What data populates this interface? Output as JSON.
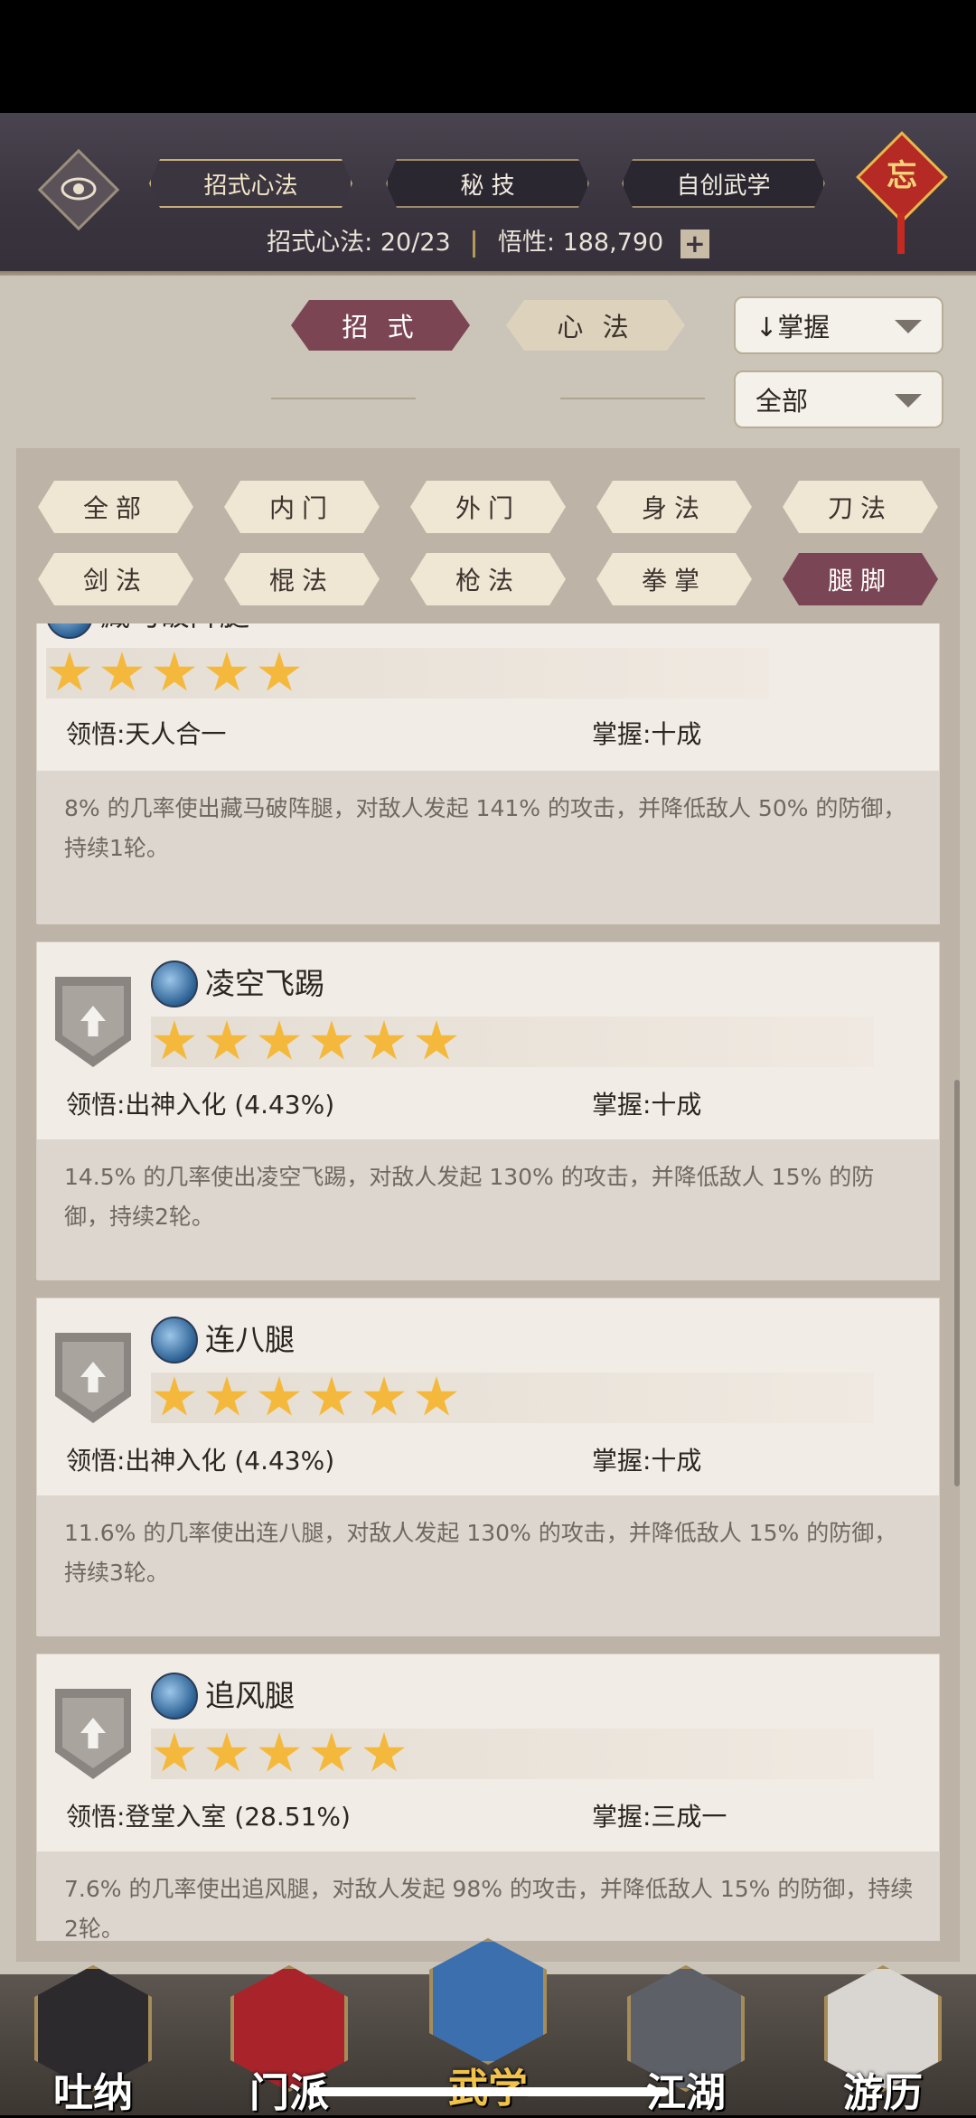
{
  "header": {
    "tabs": [
      {
        "label": "招式心法",
        "active": true
      },
      {
        "label": "秘 技",
        "active": false
      },
      {
        "label": "自创武学",
        "active": false
      }
    ],
    "stat_label": "招式心法:",
    "stat_value": "20/23",
    "wuxing_label": "悟性:",
    "wuxing_value": "188,790",
    "plus": "+",
    "charm_char": "忘"
  },
  "subtabs": [
    {
      "label": "招 式",
      "active": true
    },
    {
      "label": "心 法",
      "active": false
    }
  ],
  "sort_dropdown": {
    "value": "↓掌握"
  },
  "filter_dropdown": {
    "value": "全部"
  },
  "categories": [
    {
      "label": "全部",
      "active": false
    },
    {
      "label": "内门",
      "active": false
    },
    {
      "label": "外门",
      "active": false
    },
    {
      "label": "身法",
      "active": false
    },
    {
      "label": "刀法",
      "active": false
    },
    {
      "label": "剑法",
      "active": false
    },
    {
      "label": "棍法",
      "active": false
    },
    {
      "label": "枪法",
      "active": false
    },
    {
      "label": "拳掌",
      "active": false
    },
    {
      "label": "腿脚",
      "active": true
    }
  ],
  "skills": [
    {
      "name": "藏马破阵腿",
      "stars": 5,
      "lingwu": "领悟:天人合一",
      "zhangwo": "掌握:十成",
      "desc": "8% 的几率使出藏马破阵腿，对敌人发起 141% 的攻击，并降低敌人 50% 的防御，持续1轮。"
    },
    {
      "name": "凌空飞踢",
      "stars": 6,
      "lingwu": "领悟:出神入化 (4.43%)",
      "zhangwo": "掌握:十成",
      "desc": "14.5% 的几率使出凌空飞踢，对敌人发起 130% 的攻击，并降低敌人 15% 的防御，持续2轮。"
    },
    {
      "name": "连八腿",
      "stars": 6,
      "lingwu": "领悟:出神入化 (4.43%)",
      "zhangwo": "掌握:十成",
      "desc": "11.6% 的几率使出连八腿，对敌人发起 130% 的攻击，并降低敌人 15% 的防御，持续3轮。"
    },
    {
      "name": "追风腿",
      "stars": 5,
      "lingwu": "领悟:登堂入室 (28.51%)",
      "zhangwo": "掌握:三成一",
      "desc": "7.6% 的几率使出追风腿，对敌人发起 98% 的攻击，并降低敌人 15% 的防御，持续2轮。"
    }
  ],
  "nav": [
    {
      "label": "吐纳",
      "icon": "meditating-figure-icon",
      "active": false
    },
    {
      "label": "门派",
      "icon": "sect-banner-icon",
      "active": false
    },
    {
      "label": "武学",
      "icon": "martial-book-icon",
      "active": true
    },
    {
      "label": "江湖",
      "icon": "fishing-net-icon",
      "active": false
    },
    {
      "label": "游历",
      "icon": "white-horse-icon",
      "active": false
    }
  ]
}
